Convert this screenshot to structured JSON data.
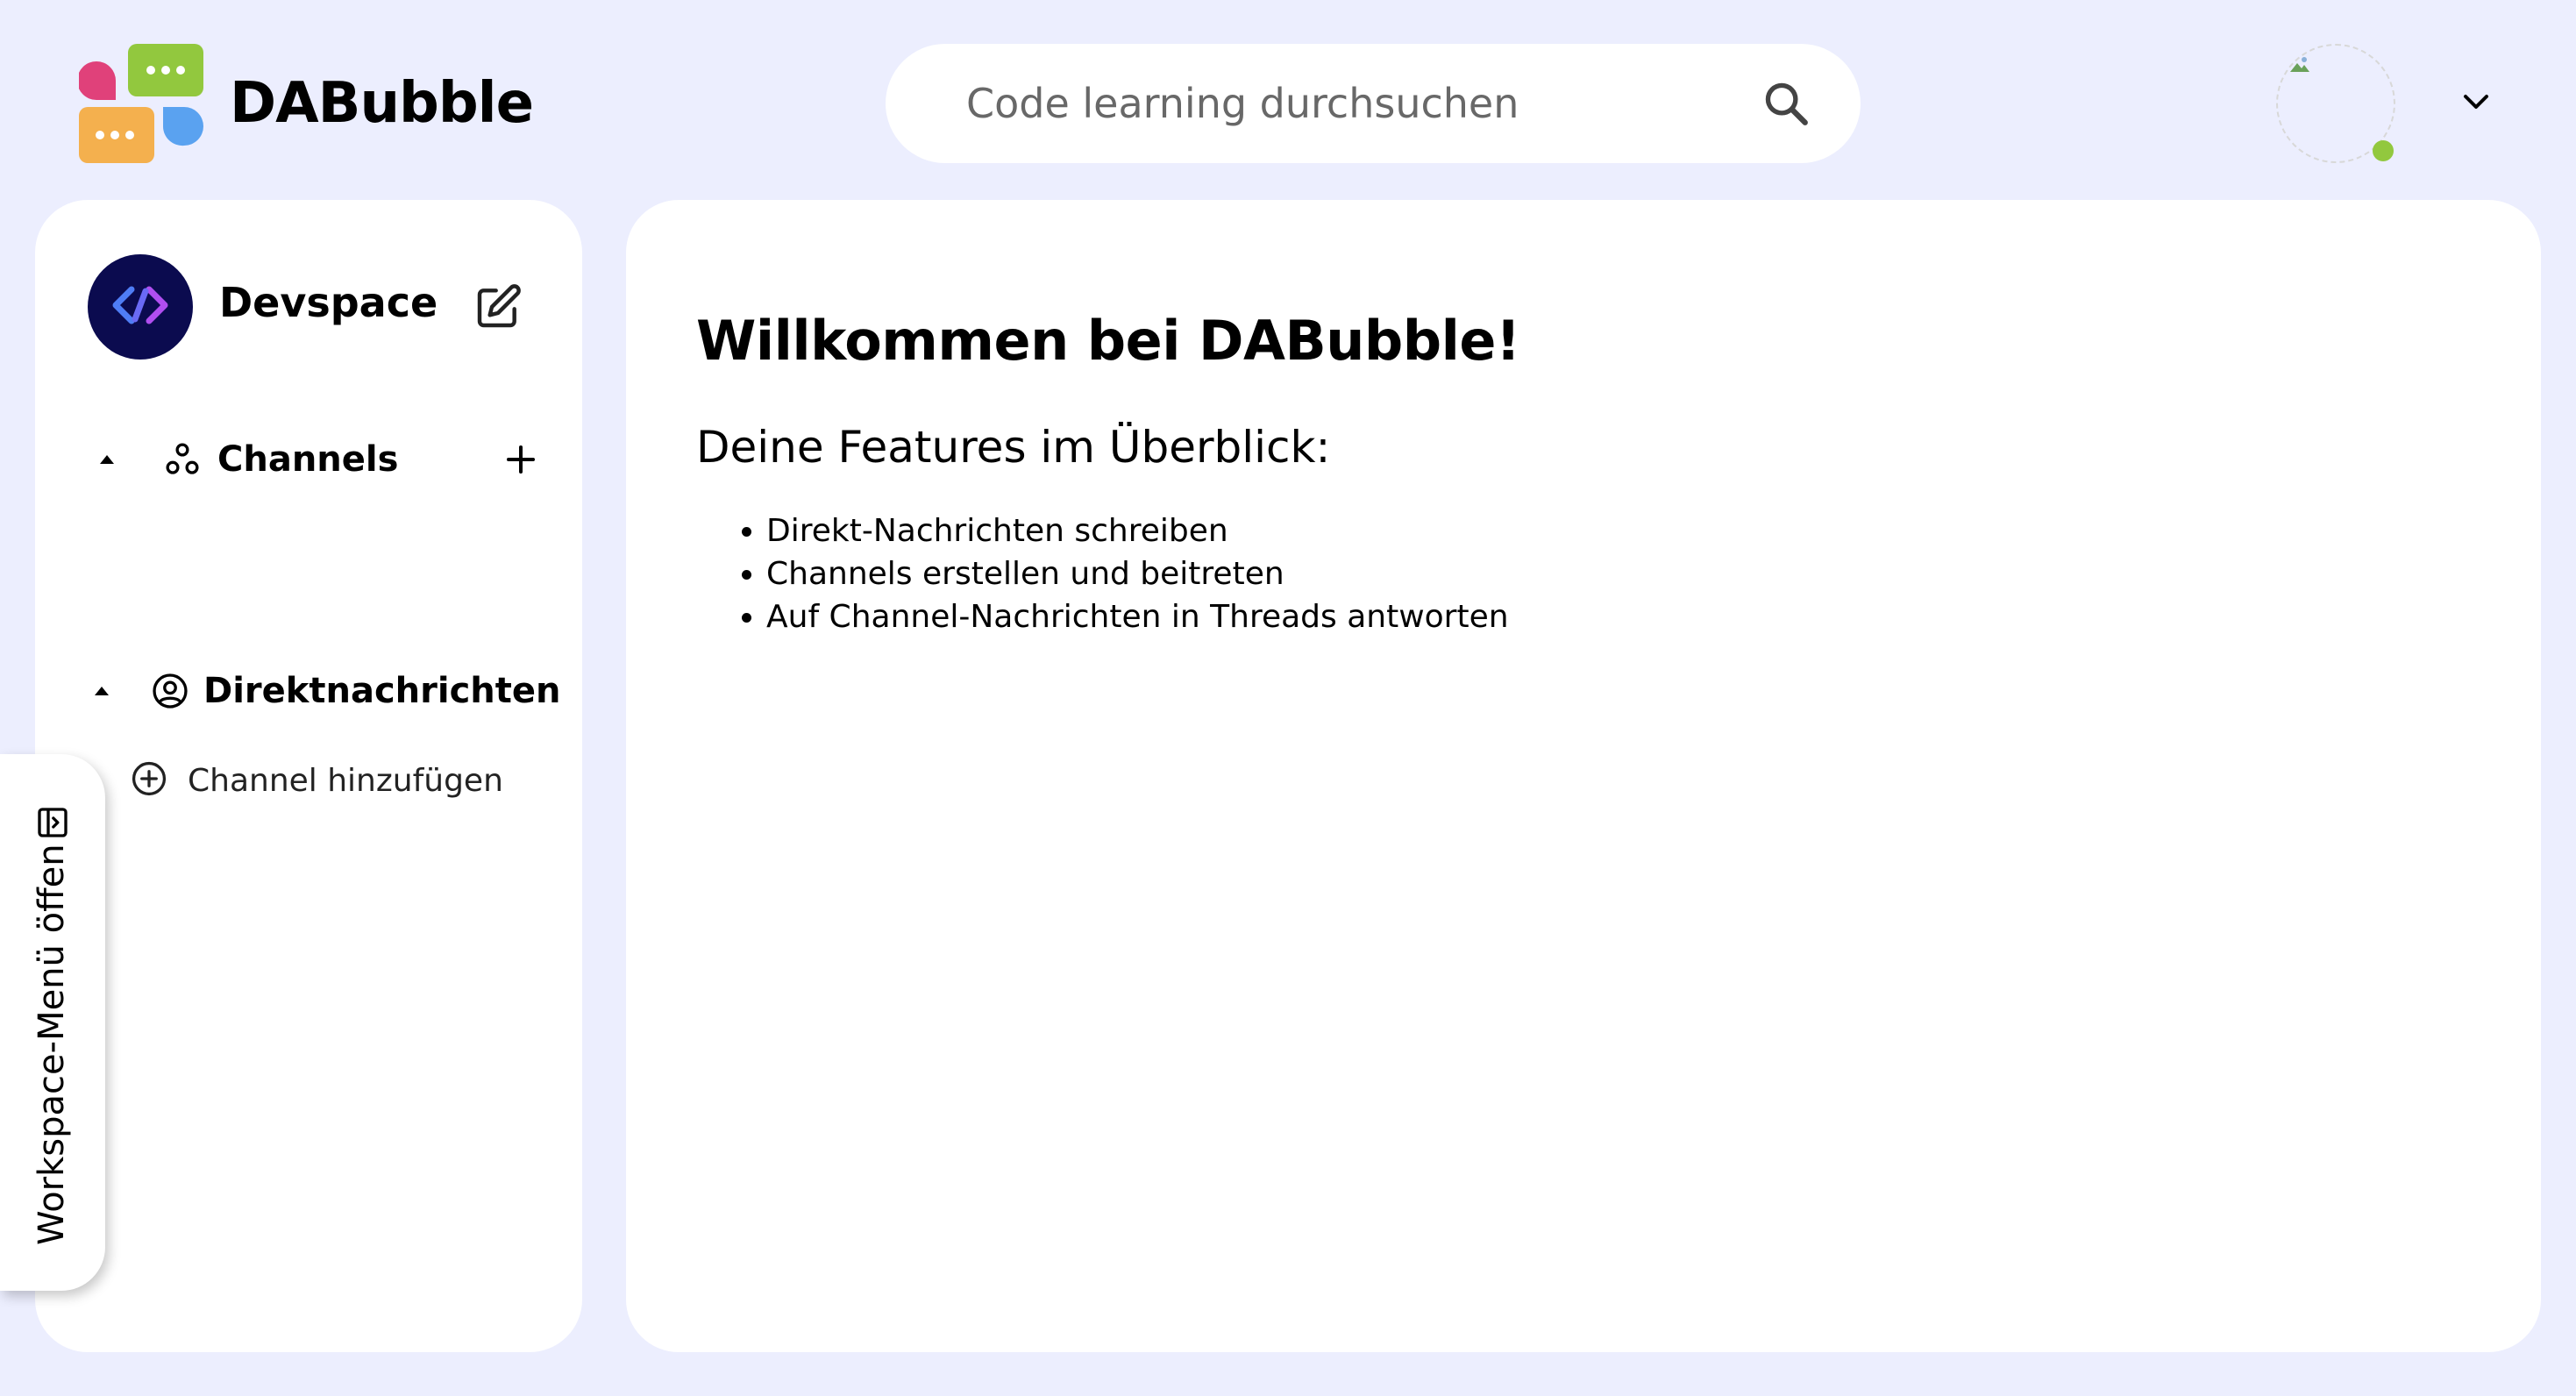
{
  "app": {
    "title": "DABubble"
  },
  "search": {
    "placeholder": "Code learning durchsuchen"
  },
  "profile": {
    "status": "online",
    "status_color": "#92c83e"
  },
  "workspace": {
    "name": "Devspace"
  },
  "sidebar": {
    "channels_label": "Channels",
    "add_channel_label": "Channel hinzufügen",
    "direct_messages_label": "Direktnachrichten"
  },
  "workspace_menu_tab": {
    "label": "Workspace-Menü öffen"
  },
  "main": {
    "heading": "Willkommen bei DABubble!",
    "subheading": "Deine Features im Überblick:",
    "features": [
      "Direkt-Nachrichten schreiben",
      "Channels erstellen und beitreten",
      "Auf Channel-Nachrichten in Threads antworten"
    ]
  },
  "icons": {
    "logo": "dabubble-logo-icon",
    "search": "search-icon",
    "chevron": "chevron-down-icon",
    "edit": "edit-icon",
    "caret": "caret-up-icon",
    "channels": "channels-icon",
    "add": "plus-icon",
    "add_circle": "add-circle-icon",
    "account": "account-circle-icon",
    "sidebar_toggle": "sidebar-toggle-icon"
  },
  "colors": {
    "background": "#eceefe",
    "panel": "#ffffff",
    "workspace_logo_bg": "#0b0b4f",
    "logo_pink": "#e0417a",
    "logo_green": "#92c83e",
    "logo_orange": "#f4b04e",
    "logo_blue": "#5aa2f0"
  }
}
